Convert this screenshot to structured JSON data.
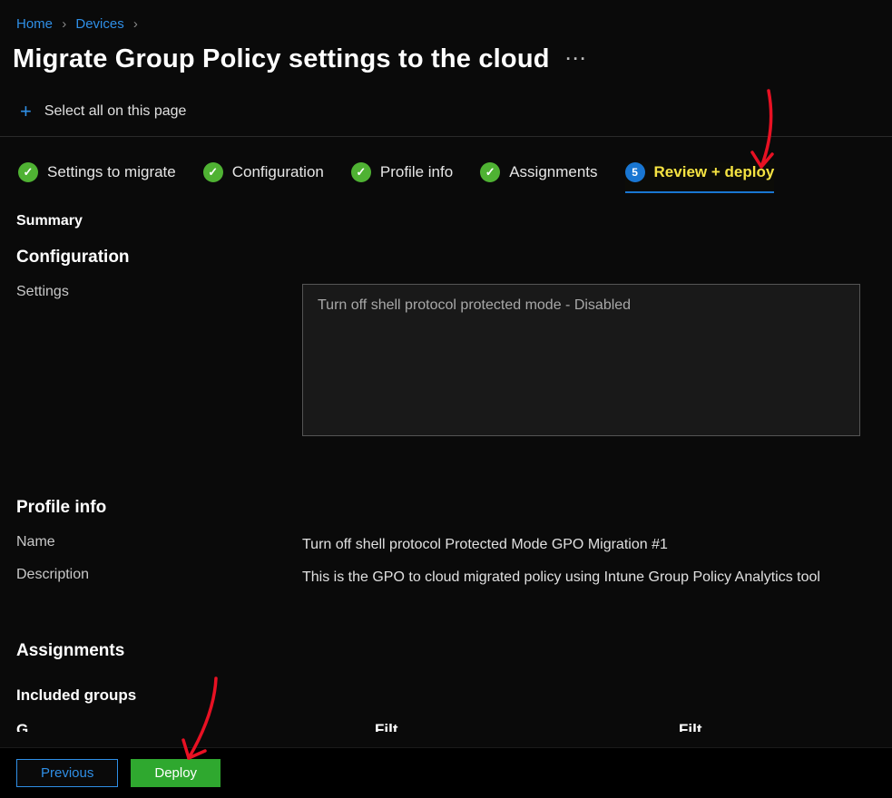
{
  "breadcrumb": {
    "home": "Home",
    "devices": "Devices",
    "separator": "›"
  },
  "page_title": "Migrate Group Policy settings to the cloud",
  "select_all": "Select all on this page",
  "steps": {
    "step1": "Settings to migrate",
    "step2": "Configuration",
    "step3": "Profile info",
    "step4": "Assignments",
    "step5_num": "5",
    "step5": "Review + deploy"
  },
  "summary_heading": "Summary",
  "configuration_heading": "Configuration",
  "settings_label": "Settings",
  "settings_value": "Turn off shell protocol protected mode - Disabled",
  "profile_info_heading": "Profile info",
  "name_label": "Name",
  "name_value": "Turn off shell protocol Protected Mode  GPO Migration #1",
  "description_label": "Description",
  "description_value": "This is the GPO to cloud migrated policy using Intune Group Policy Analytics tool",
  "assignments_heading": "Assignments",
  "included_groups_heading": "Included groups",
  "footer": {
    "previous": "Previous",
    "deploy": "Deploy"
  }
}
